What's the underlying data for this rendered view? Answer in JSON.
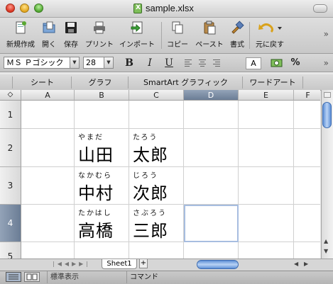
{
  "window": {
    "title": "sample.xlsx"
  },
  "toolbar": {
    "buttons": [
      {
        "label": "新規作成",
        "icon": "new-workbook-icon"
      },
      {
        "label": "開く",
        "icon": "open-folder-icon"
      },
      {
        "label": "保存",
        "icon": "save-disk-icon"
      },
      {
        "label": "プリント",
        "icon": "printer-icon"
      },
      {
        "label": "インポート",
        "icon": "import-icon"
      },
      {
        "label": "コピー",
        "icon": "copy-icon"
      },
      {
        "label": "ペースト",
        "icon": "paste-icon"
      },
      {
        "label": "書式",
        "icon": "format-brush-icon"
      },
      {
        "label": "元に戻す",
        "icon": "undo-icon"
      }
    ]
  },
  "formatbar": {
    "font_name": "ＭＳ Ｐゴシック",
    "font_size": "28",
    "bold": "B",
    "italic": "I",
    "underline": "U",
    "percent": "%"
  },
  "gallery": {
    "tabs": [
      "シート",
      "グラフ",
      "SmartArt グラフィック",
      "ワードアート"
    ]
  },
  "sheet": {
    "columns": [
      "A",
      "B",
      "C",
      "D",
      "E",
      "F"
    ],
    "rows": [
      "1",
      "2",
      "3",
      "4",
      "5"
    ],
    "selected_column": "D",
    "selected_row": "4",
    "cells": {
      "B2": {
        "ruby": "やまだ",
        "text": "山田"
      },
      "C2": {
        "ruby": "たろう",
        "text": "太郎"
      },
      "B3": {
        "ruby": "なかむら",
        "text": "中村"
      },
      "C3": {
        "ruby": "じろう",
        "text": "次郎"
      },
      "B4": {
        "ruby": "たかはし",
        "text": "高橋"
      },
      "C4": {
        "ruby": "さぶろう",
        "text": "三郎"
      }
    }
  },
  "sheettabs": {
    "active": "Sheet1",
    "add": "+"
  },
  "status": {
    "view": "標準表示",
    "mode": "コマンド"
  },
  "colors": {
    "selection_header": "#7a8ba3",
    "scroll_thumb": "#5d8fd6",
    "active_cell_border": "#a7bde0"
  }
}
